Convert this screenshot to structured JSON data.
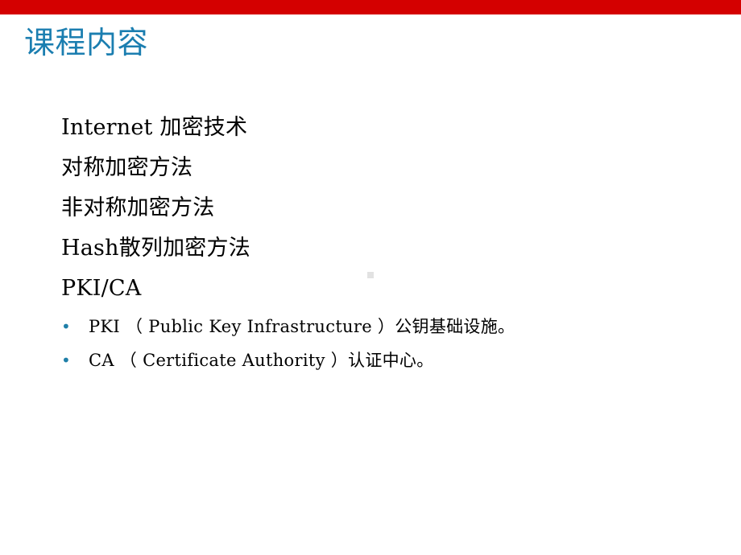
{
  "slide": {
    "title": "课程内容",
    "accent_bar_color": "#d40000",
    "title_color": "#1b7eb0",
    "bullet_color": "#1f7fa8",
    "background_color": "#ffffff",
    "outline_items": [
      "Internet 加密技术",
      "对称加密方法",
      "非对称加密方法",
      "Hash散列加密方法",
      "PKI/CA"
    ],
    "bullets": [
      {
        "marker": "•",
        "text": "PKI （ Public Key Infrastructure ）公钥基础设施。"
      },
      {
        "marker": "•",
        "text": "CA （ Certificate Authority ）认证中心。"
      }
    ]
  }
}
